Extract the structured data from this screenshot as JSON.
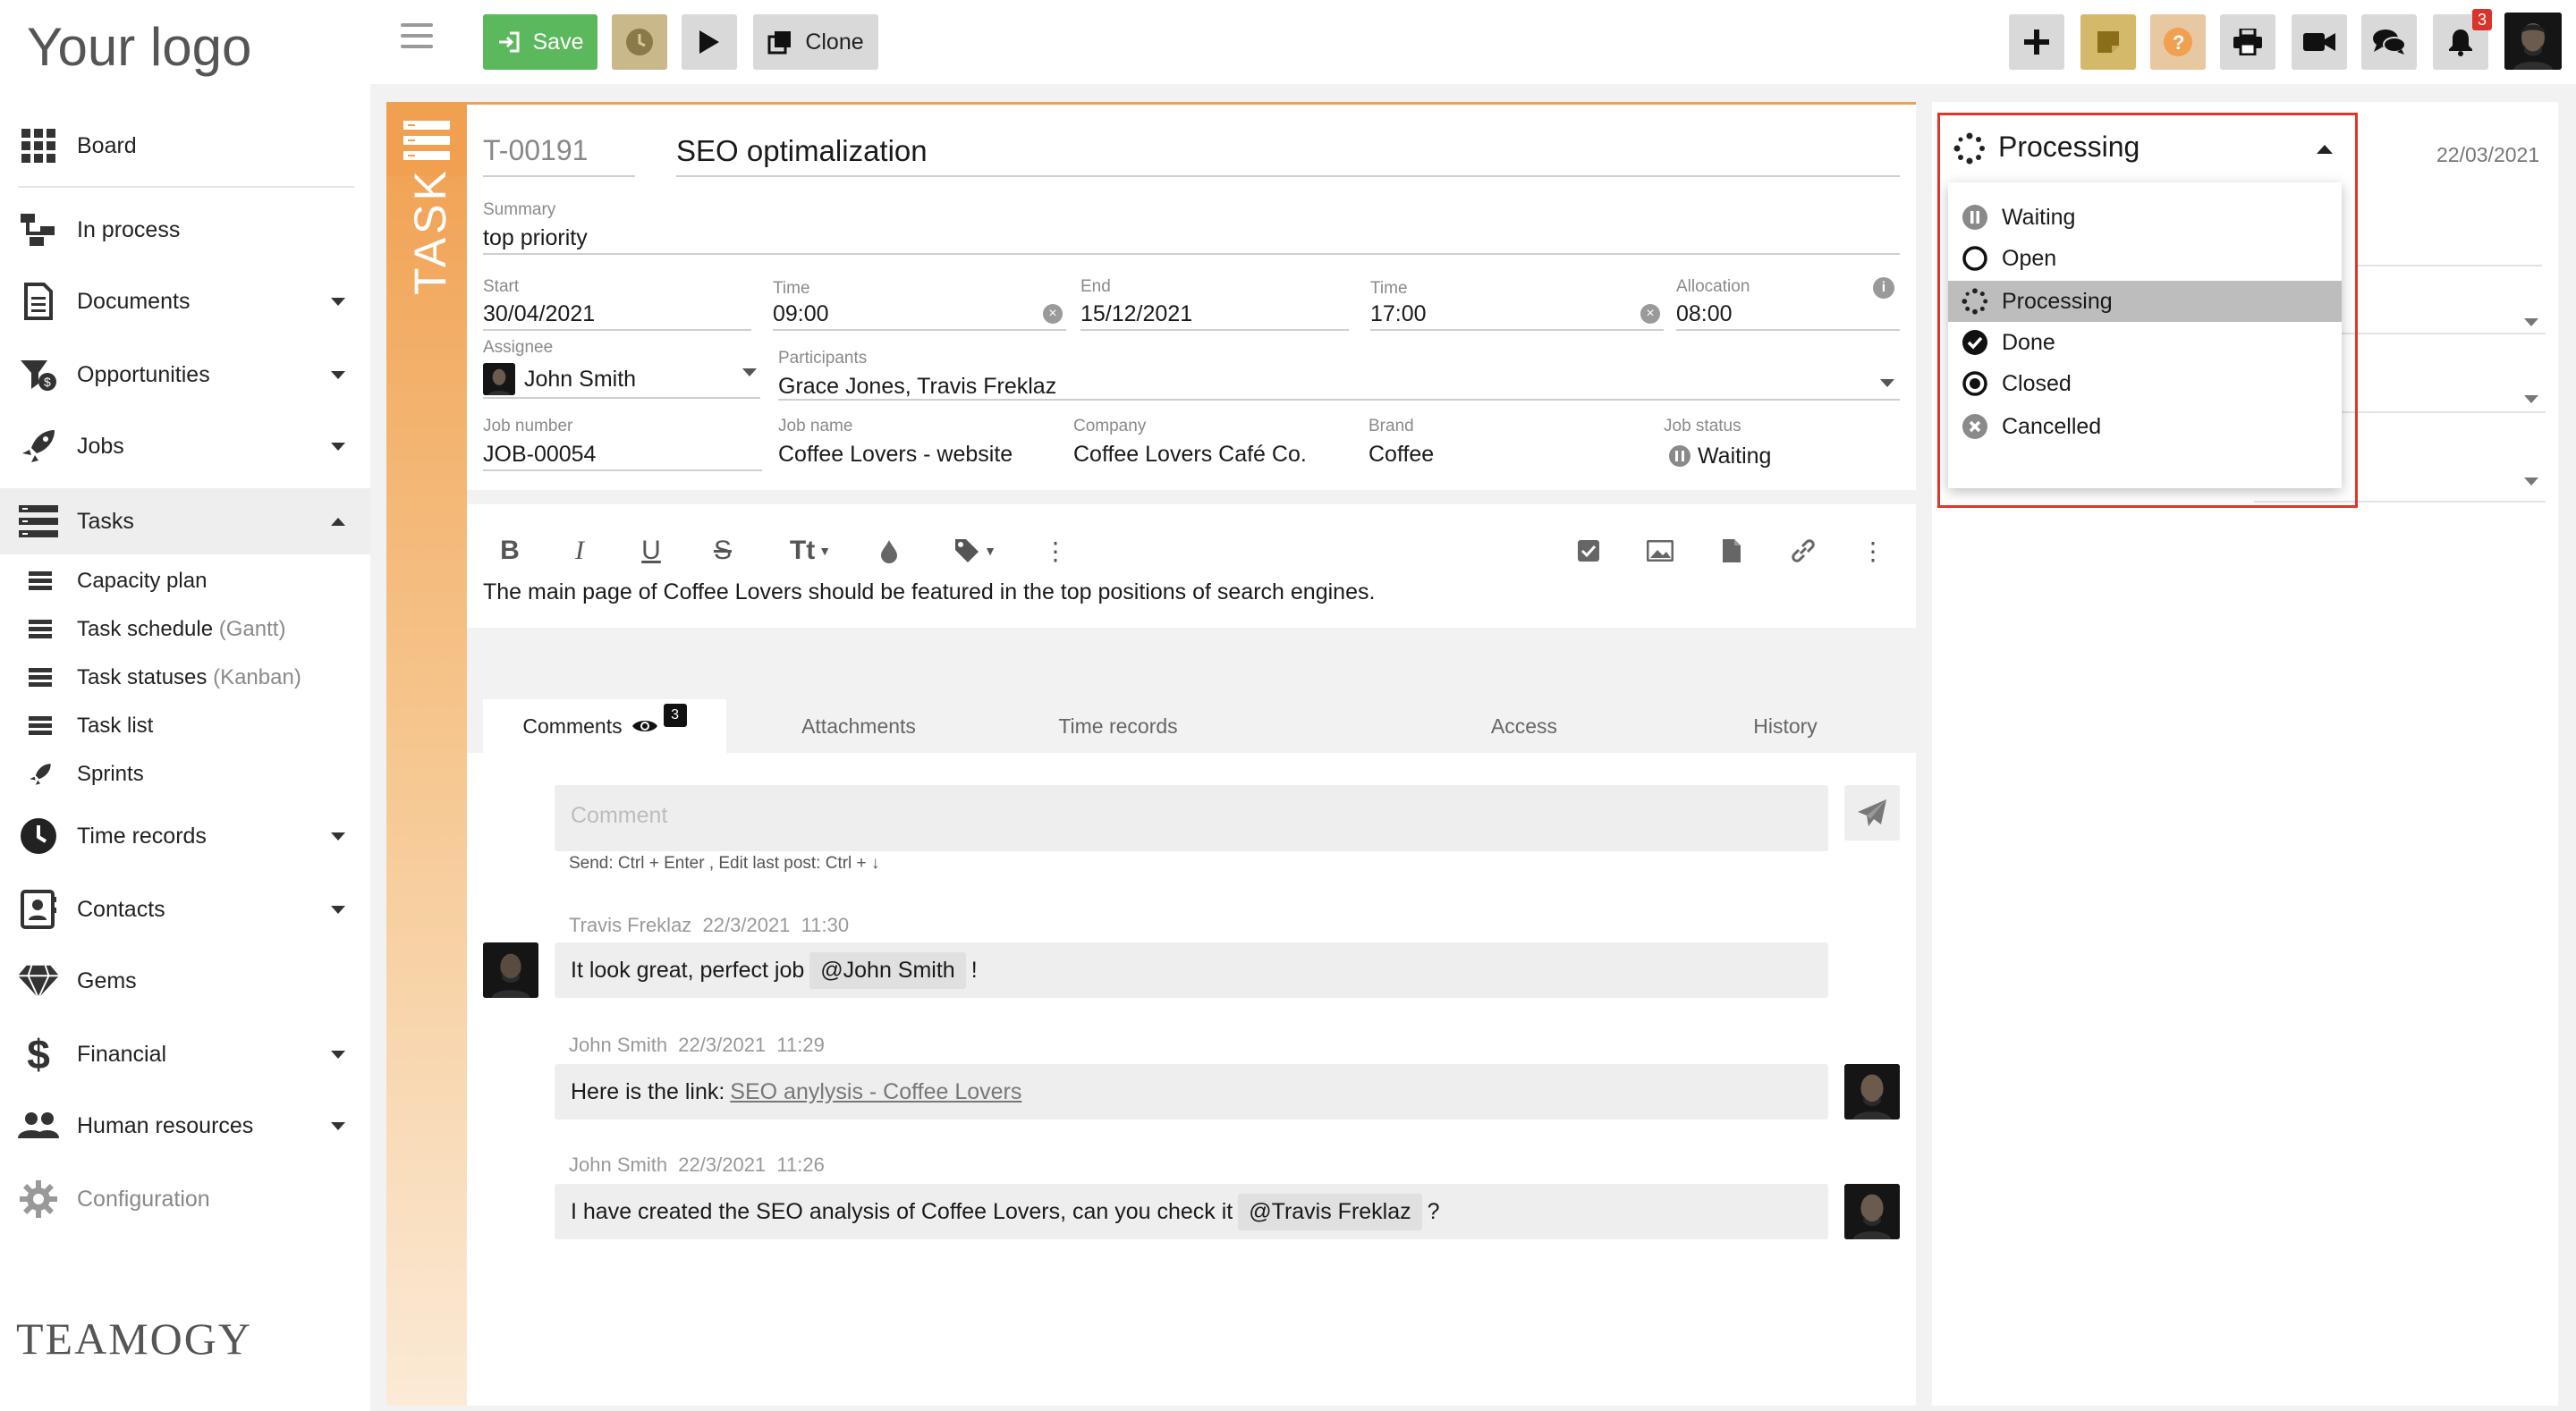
{
  "brand": {
    "logo_text": "Your logo",
    "footer_logo": "TEAMOGY"
  },
  "sidebar": {
    "items": [
      {
        "label": "Board",
        "icon": "grid-icon"
      },
      {
        "label": "In process",
        "icon": "flow-icon"
      },
      {
        "label": "Documents",
        "icon": "document-icon"
      },
      {
        "label": "Opportunities",
        "icon": "opportunity-icon"
      },
      {
        "label": "Jobs",
        "icon": "rocket-icon"
      },
      {
        "label": "Tasks",
        "icon": "tasks-icon"
      },
      {
        "label": "Time records",
        "icon": "clock-icon"
      },
      {
        "label": "Contacts",
        "icon": "contacts-icon"
      },
      {
        "label": "Gems",
        "icon": "gem-icon"
      },
      {
        "label": "Financial",
        "icon": "dollar-icon"
      },
      {
        "label": "Human resources",
        "icon": "people-icon"
      },
      {
        "label": "Configuration",
        "icon": "gear-icon"
      }
    ],
    "task_subitems": [
      {
        "label": "Capacity plan",
        "suffix": ""
      },
      {
        "label": "Task schedule",
        "suffix": "(Gantt)"
      },
      {
        "label": "Task statuses",
        "suffix": "(Kanban)"
      },
      {
        "label": "Task list",
        "suffix": ""
      },
      {
        "label": "Sprints",
        "suffix": ""
      }
    ]
  },
  "toolbar": {
    "save_label": "Save",
    "clone_label": "Clone",
    "notification_count": "3",
    "accent_green": "#5cb85c",
    "accent_orange": "#f0a050"
  },
  "task": {
    "strip_label": "TASK",
    "id": "T-00191",
    "title": "SEO optimalization",
    "summary_label": "Summary",
    "summary": "top priority",
    "start_label": "Start",
    "start": "30/04/2021",
    "start_time_label": "Time",
    "start_time": "09:00",
    "end_label": "End",
    "end": "15/12/2021",
    "end_time_label": "Time",
    "end_time": "17:00",
    "allocation_label": "Allocation",
    "allocation": "08:00",
    "assignee_label": "Assignee",
    "assignee": "John Smith",
    "participants_label": "Participants",
    "participants": "Grace Jones, Travis Freklaz",
    "job_number_label": "Job number",
    "job_number": "JOB-00054",
    "job_name_label": "Job name",
    "job_name": "Coffee Lovers - website",
    "company_label": "Company",
    "company": "Coffee Lovers Café Co.",
    "brand_label": "Brand",
    "brand": "Coffee",
    "job_status_label": "Job status",
    "job_status": "Waiting",
    "description": "The main page of Coffee Lovers should be featured in the top positions of search engines."
  },
  "tabs": {
    "comments": "Comments",
    "comments_count": "3",
    "attachments": "Attachments",
    "time_records": "Time records",
    "access": "Access",
    "history": "History"
  },
  "comments": {
    "placeholder": "Comment",
    "hint": "Send: Ctrl + Enter , Edit last post: Ctrl + ↓",
    "items": [
      {
        "author": "Travis Freklaz",
        "date": "22/3/2021",
        "time": "11:30",
        "text_before": "It look great, perfect job",
        "mention": "@John Smith",
        "text_after": "!"
      },
      {
        "author": "John Smith",
        "date": "22/3/2021",
        "time": "11:29",
        "text_before": "Here is the link:",
        "link": "SEO anylysis - Coffee Lovers"
      },
      {
        "author": "John Smith",
        "date": "22/3/2021",
        "time": "11:26",
        "text_before": "I have created the SEO analysis of Coffee Lovers, can you check it",
        "mention": "@Travis Freklaz",
        "text_after": "?"
      }
    ]
  },
  "right_panel": {
    "date": "22/03/2021",
    "status_current": "Processing",
    "status_options": [
      "Waiting",
      "Open",
      "Processing",
      "Done",
      "Closed",
      "Cancelled"
    ],
    "highlight_color": "#e0352b"
  }
}
